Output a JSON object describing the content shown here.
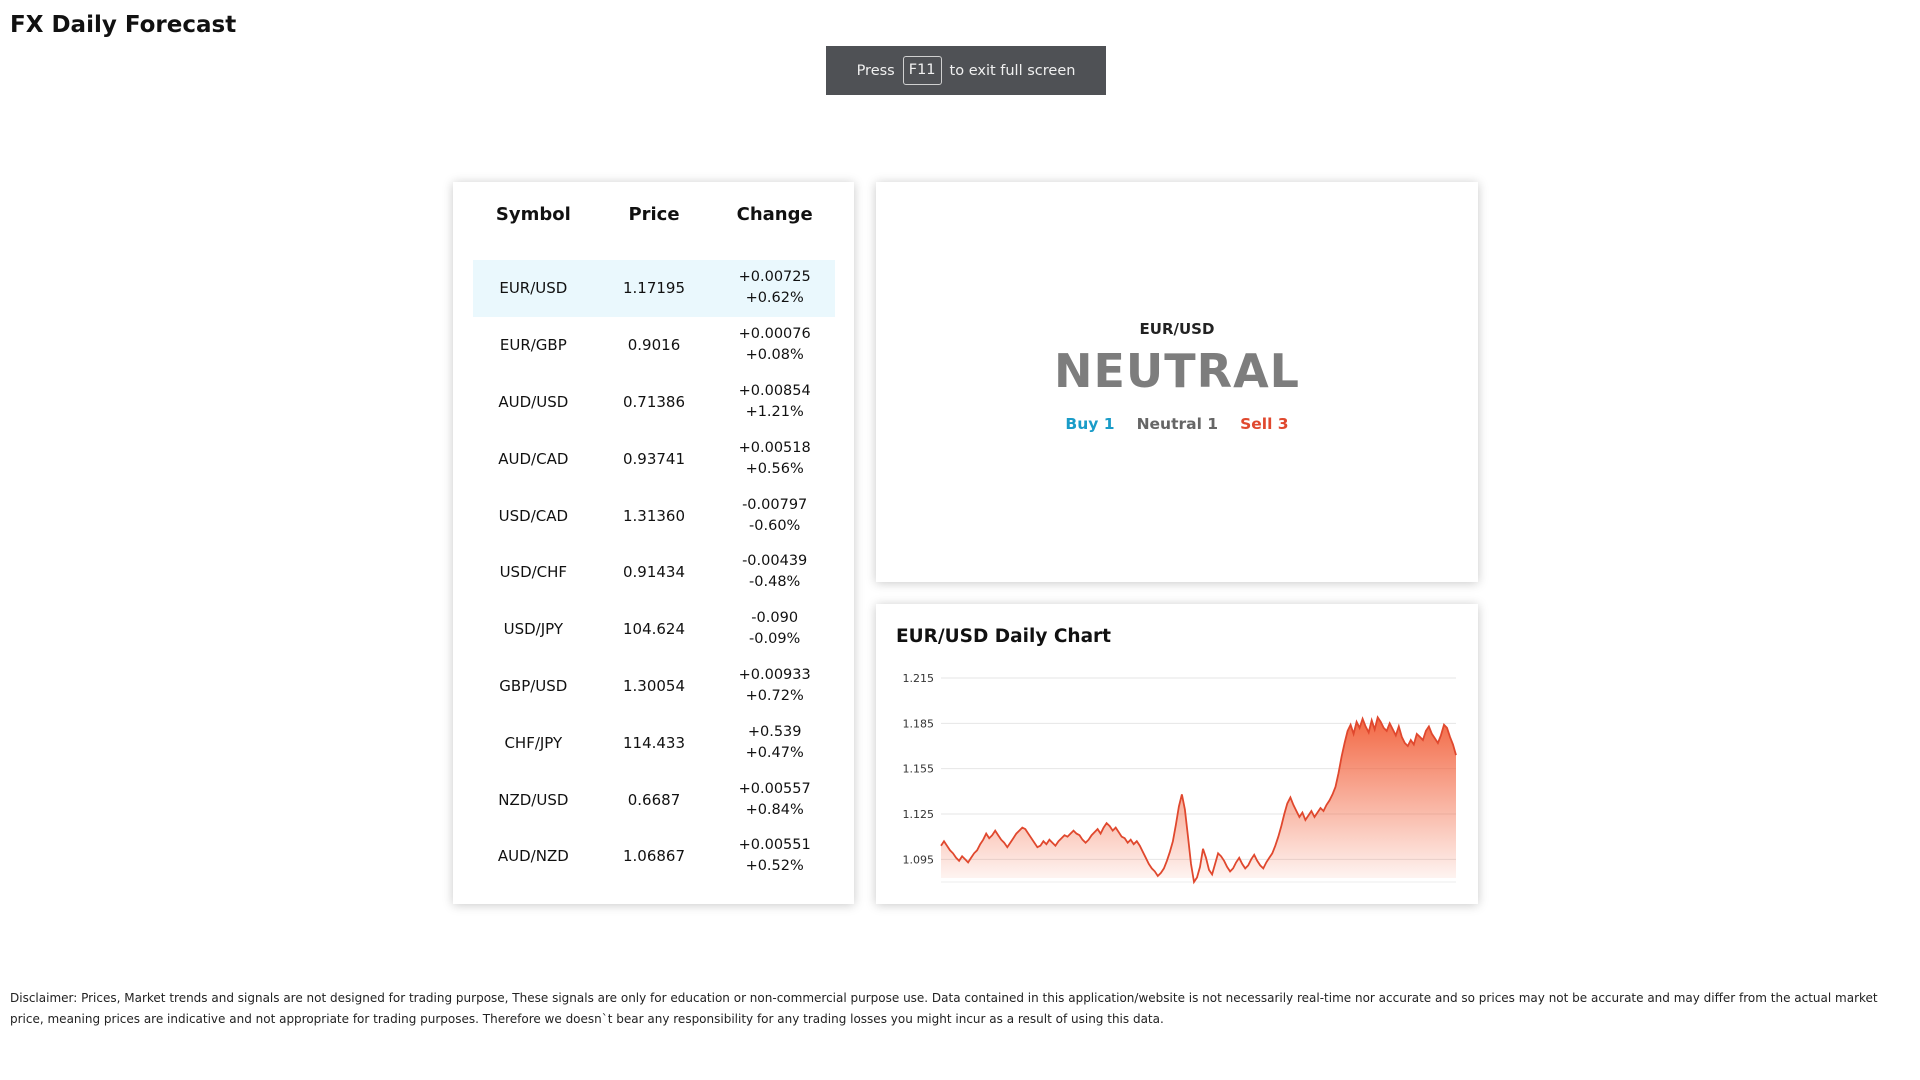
{
  "app": {
    "title": "FX Daily Forecast"
  },
  "fullscreen_notice": {
    "before": "Press",
    "key": "F11",
    "after": "to exit full screen"
  },
  "quotes": {
    "headers": {
      "symbol": "Symbol",
      "price": "Price",
      "change": "Change"
    },
    "selected_index": 0,
    "rows": [
      {
        "symbol": "EUR/USD",
        "price": "1.17195",
        "change": "+0.00725",
        "pct": "+0.62%",
        "dir": "up"
      },
      {
        "symbol": "EUR/GBP",
        "price": "0.9016",
        "change": "+0.00076",
        "pct": "+0.08%",
        "dir": "up"
      },
      {
        "symbol": "AUD/USD",
        "price": "0.71386",
        "change": "+0.00854",
        "pct": "+1.21%",
        "dir": "up"
      },
      {
        "symbol": "AUD/CAD",
        "price": "0.93741",
        "change": "+0.00518",
        "pct": "+0.56%",
        "dir": "up"
      },
      {
        "symbol": "USD/CAD",
        "price": "1.31360",
        "change": "-0.00797",
        "pct": "-0.60%",
        "dir": "down"
      },
      {
        "symbol": "USD/CHF",
        "price": "0.91434",
        "change": "-0.00439",
        "pct": "-0.48%",
        "dir": "down"
      },
      {
        "symbol": "USD/JPY",
        "price": "104.624",
        "change": "-0.090",
        "pct": "-0.09%",
        "dir": "down"
      },
      {
        "symbol": "GBP/USD",
        "price": "1.30054",
        "change": "+0.00933",
        "pct": "+0.72%",
        "dir": "up"
      },
      {
        "symbol": "CHF/JPY",
        "price": "114.433",
        "change": "+0.539",
        "pct": "+0.47%",
        "dir": "up"
      },
      {
        "symbol": "NZD/USD",
        "price": "0.6687",
        "change": "+0.00557",
        "pct": "+0.84%",
        "dir": "up"
      },
      {
        "symbol": "AUD/NZD",
        "price": "1.06867",
        "change": "+0.00551",
        "pct": "+0.52%",
        "dir": "up"
      }
    ]
  },
  "signal": {
    "symbol": "EUR/USD",
    "verdict": "NEUTRAL",
    "buy": "Buy 1",
    "neutral": "Neutral 1",
    "sell": "Sell 3"
  },
  "colors": {
    "up": "#1a9cc8",
    "down": "#e0482e",
    "neutral": "#7d7d7d",
    "area": "#f2603a"
  },
  "chart": {
    "title": "EUR/USD Daily Chart"
  },
  "chart_data": {
    "type": "area",
    "title": "EUR/USD Daily Chart",
    "y_ticks": [
      "1.215",
      "1.185",
      "1.155",
      "1.125",
      "1.095"
    ],
    "ylim": [
      1.08,
      1.215
    ],
    "grid": true,
    "values": [
      1.104,
      1.107,
      1.104,
      1.101,
      1.099,
      1.096,
      1.094,
      1.097,
      1.095,
      1.093,
      1.096,
      1.099,
      1.101,
      1.105,
      1.108,
      1.112,
      1.109,
      1.111,
      1.114,
      1.111,
      1.108,
      1.106,
      1.103,
      1.106,
      1.109,
      1.112,
      1.114,
      1.116,
      1.115,
      1.112,
      1.109,
      1.106,
      1.103,
      1.104,
      1.107,
      1.105,
      1.108,
      1.106,
      1.104,
      1.107,
      1.109,
      1.111,
      1.11,
      1.112,
      1.114,
      1.112,
      1.111,
      1.108,
      1.106,
      1.108,
      1.111,
      1.113,
      1.115,
      1.112,
      1.116,
      1.119,
      1.117,
      1.114,
      1.116,
      1.113,
      1.11,
      1.109,
      1.106,
      1.108,
      1.105,
      1.107,
      1.104,
      1.1,
      1.096,
      1.092,
      1.089,
      1.087,
      1.084,
      1.086,
      1.089,
      1.094,
      1.1,
      1.107,
      1.118,
      1.13,
      1.138,
      1.128,
      1.11,
      1.092,
      1.08,
      1.083,
      1.09,
      1.102,
      1.096,
      1.088,
      1.085,
      1.092,
      1.099,
      1.097,
      1.094,
      1.09,
      1.087,
      1.089,
      1.093,
      1.096,
      1.092,
      1.089,
      1.091,
      1.095,
      1.098,
      1.094,
      1.091,
      1.089,
      1.093,
      1.096,
      1.099,
      1.104,
      1.11,
      1.117,
      1.125,
      1.132,
      1.136,
      1.131,
      1.127,
      1.123,
      1.126,
      1.121,
      1.124,
      1.127,
      1.123,
      1.126,
      1.129,
      1.127,
      1.131,
      1.134,
      1.138,
      1.143,
      1.152,
      1.163,
      1.172,
      1.18,
      1.184,
      1.178,
      1.186,
      1.182,
      1.188,
      1.183,
      1.179,
      1.187,
      1.181,
      1.189,
      1.186,
      1.182,
      1.18,
      1.185,
      1.181,
      1.177,
      1.183,
      1.176,
      1.172,
      1.17,
      1.174,
      1.171,
      1.178,
      1.176,
      1.174,
      1.18,
      1.183,
      1.178,
      1.175,
      1.172,
      1.177,
      1.184,
      1.182,
      1.176,
      1.171,
      1.164
    ]
  },
  "disclaimer": "Disclaimer: Prices, Market trends and signals are not designed for trading purpose, These signals are only for education or non-commercial purpose use. Data contained in this application/website is not necessarily real-time nor accurate and so prices may not be accurate and may differ from the actual market price, meaning prices are indicative and not appropriate for trading purposes. Therefore we doesn`t bear any responsibility for any trading losses you might incur as a result of using this data."
}
